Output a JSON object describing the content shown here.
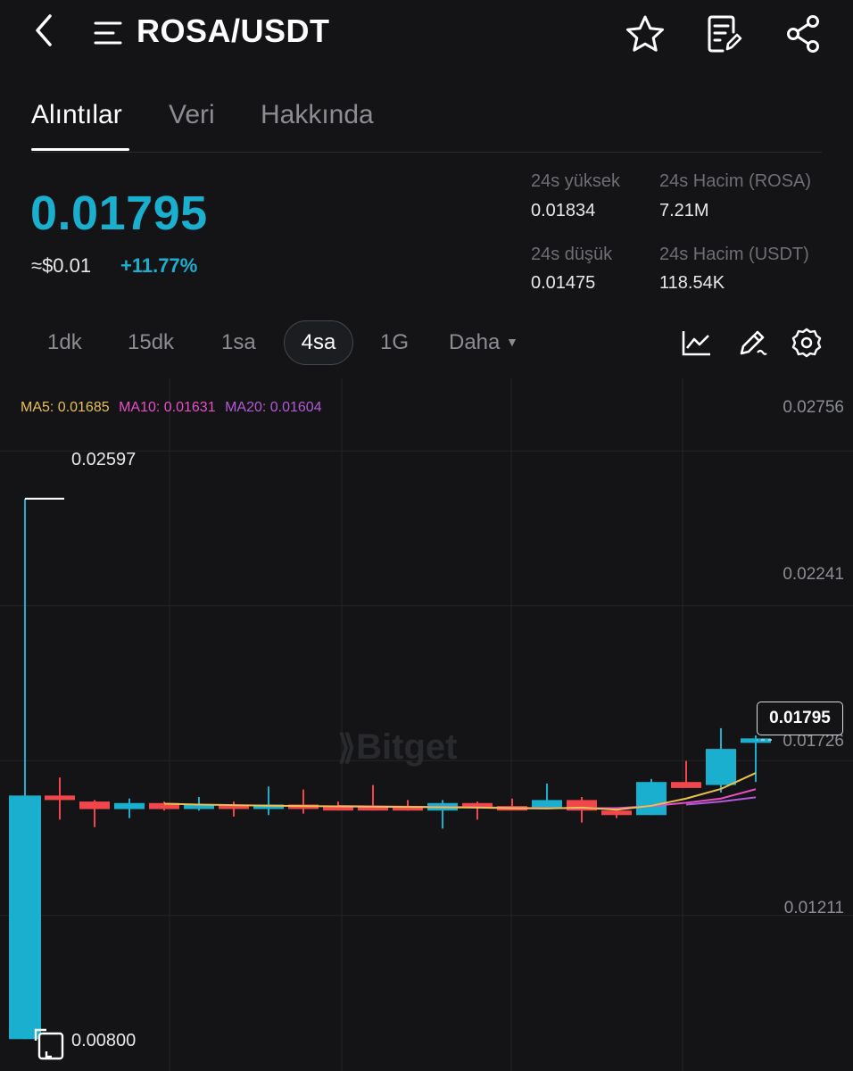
{
  "header": {
    "title": "ROSA/USDT",
    "back_icon": "back-arrow-icon",
    "menu_icon": "menu-icon",
    "favorite_icon": "star-icon",
    "notes_icon": "note-edit-icon",
    "share_icon": "share-icon"
  },
  "tabs": [
    {
      "label": "Alıntılar",
      "active": true
    },
    {
      "label": "Veri",
      "active": false
    },
    {
      "label": "Hakkında",
      "active": false
    }
  ],
  "ticker": {
    "price": "0.01795",
    "fiat": "≈$0.01",
    "change": "+11.77%",
    "high_label": "24s yüksek",
    "high": "0.01834",
    "low_label": "24s düşük",
    "low": "0.01475",
    "vol_base_label": "24s Hacim (ROSA)",
    "vol_base": "7.21M",
    "vol_quote_label": "24s Hacim (USDT)",
    "vol_quote": "118.54K"
  },
  "timeframes": {
    "items": [
      "1dk",
      "15dk",
      "1sa",
      "4sa",
      "1G"
    ],
    "active": "4sa",
    "more": "Daha",
    "tools": [
      "line-chart-icon",
      "draw-pen-icon",
      "settings-gear-icon"
    ]
  },
  "indicators": {
    "ma5": "MA5: 0.01685",
    "ma10": "MA10: 0.01631",
    "ma20": "MA20: 0.01604"
  },
  "colors": {
    "accent": "#1aafce",
    "up": "#1aafce",
    "down": "#f0464c",
    "ma5": "#ebc04e",
    "ma10": "#e84fc7",
    "ma20": "#b35ad8",
    "background": "#141416"
  },
  "watermark": "Bitget",
  "chart_data": {
    "type": "candlestick",
    "y_ticks": [
      "0.02756",
      "0.02241",
      "0.01726",
      "0.01211"
    ],
    "y_tick_values": [
      0.02756,
      0.02241,
      0.01726,
      0.01211
    ],
    "ylim": [
      0.00694,
      0.02997
    ],
    "high_marker": "0.02597",
    "low_marker": "0.00800",
    "current_price": "0.01795",
    "candles": [
      {
        "o": 0.008,
        "h": 0.02597,
        "l": 0.008,
        "c": 0.0161
      },
      {
        "o": 0.0161,
        "h": 0.0167,
        "l": 0.0153,
        "c": 0.01595
      },
      {
        "o": 0.0159,
        "h": 0.01595,
        "l": 0.01505,
        "c": 0.01565
      },
      {
        "o": 0.01565,
        "h": 0.016,
        "l": 0.01535,
        "c": 0.01585
      },
      {
        "o": 0.01585,
        "h": 0.0159,
        "l": 0.0156,
        "c": 0.01565
      },
      {
        "o": 0.01575,
        "h": 0.01605,
        "l": 0.0156,
        "c": 0.0158
      },
      {
        "o": 0.0158,
        "h": 0.0159,
        "l": 0.0154,
        "c": 0.0157
      },
      {
        "o": 0.0157,
        "h": 0.0164,
        "l": 0.01545,
        "c": 0.0158
      },
      {
        "o": 0.0158,
        "h": 0.0163,
        "l": 0.0155,
        "c": 0.0157
      },
      {
        "o": 0.01575,
        "h": 0.0159,
        "l": 0.0156,
        "c": 0.0157
      },
      {
        "o": 0.01575,
        "h": 0.01645,
        "l": 0.0156,
        "c": 0.01572
      },
      {
        "o": 0.01575,
        "h": 0.01595,
        "l": 0.0156,
        "c": 0.0156
      },
      {
        "o": 0.0156,
        "h": 0.01595,
        "l": 0.015,
        "c": 0.01585
      },
      {
        "o": 0.01585,
        "h": 0.0159,
        "l": 0.0153,
        "c": 0.0157
      },
      {
        "o": 0.01575,
        "h": 0.016,
        "l": 0.01565,
        "c": 0.0157
      },
      {
        "o": 0.0157,
        "h": 0.0165,
        "l": 0.01565,
        "c": 0.01595
      },
      {
        "o": 0.01595,
        "h": 0.01605,
        "l": 0.0152,
        "c": 0.0156
      },
      {
        "o": 0.0156,
        "h": 0.0157,
        "l": 0.01535,
        "c": 0.01545
      },
      {
        "o": 0.01545,
        "h": 0.01665,
        "l": 0.01545,
        "c": 0.01655
      },
      {
        "o": 0.01655,
        "h": 0.01725,
        "l": 0.0164,
        "c": 0.01635
      },
      {
        "o": 0.01645,
        "h": 0.01834,
        "l": 0.0162,
        "c": 0.01765
      },
      {
        "o": 0.01795,
        "h": 0.0181,
        "l": 0.01655,
        "c": 0.018
      }
    ],
    "ma5": [
      null,
      null,
      null,
      null,
      0.01583,
      0.0158,
      0.01578,
      0.01576,
      0.01575,
      0.01574,
      0.01573,
      0.01572,
      0.01571,
      0.0157,
      0.01568,
      0.01567,
      0.0157,
      0.01563,
      0.01576,
      0.016,
      0.01632,
      0.01685
    ],
    "ma10": [
      null,
      null,
      null,
      null,
      null,
      null,
      null,
      null,
      null,
      0.01575,
      0.01574,
      0.01573,
      0.01572,
      0.01571,
      0.01569,
      0.01568,
      0.01568,
      0.01568,
      0.01575,
      0.01586,
      0.016,
      0.01631
    ],
    "ma20": [
      null,
      null,
      null,
      null,
      null,
      null,
      null,
      null,
      null,
      null,
      null,
      null,
      null,
      null,
      null,
      null,
      null,
      null,
      null,
      0.0158,
      0.0159,
      0.01604
    ]
  }
}
